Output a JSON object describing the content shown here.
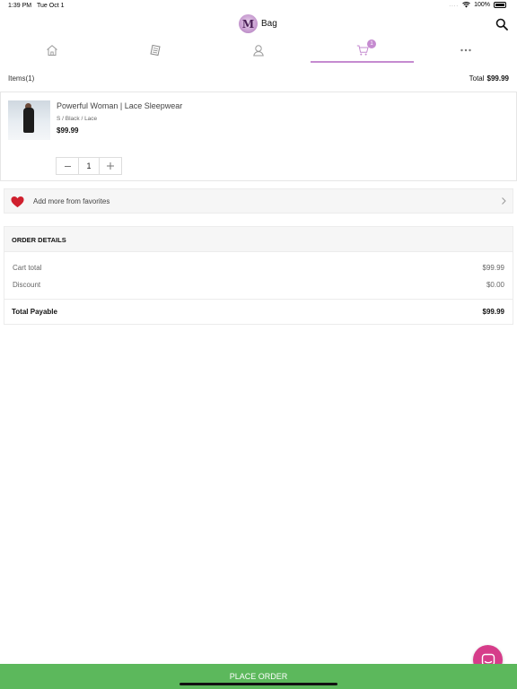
{
  "status_bar": {
    "time": "1:39 PM",
    "date": "Tue Oct 1",
    "signal": "....",
    "battery": "100%"
  },
  "header": {
    "logo_letter": "M",
    "title": "Bag"
  },
  "tabs": [
    {
      "name": "home",
      "icon": "home-icon"
    },
    {
      "name": "catalog",
      "icon": "catalog-icon"
    },
    {
      "name": "account",
      "icon": "user-icon"
    },
    {
      "name": "bag",
      "icon": "cart-icon",
      "badge": "1",
      "active": true
    },
    {
      "name": "more",
      "icon": "more-icon"
    }
  ],
  "summary": {
    "items_label": "Items(1)",
    "total_label": "Total",
    "total_value": "$99.99"
  },
  "cart": {
    "items": [
      {
        "name": "Powerful Woman | Lace Sleepwear",
        "variant": "S / Black / Lace",
        "price": "$99.99",
        "quantity": "1"
      }
    ]
  },
  "favorites": {
    "label": "Add more from favorites"
  },
  "order_details": {
    "title": "ORDER DETAILS",
    "cart_total_label": "Cart total",
    "cart_total_value": "$99.99",
    "discount_label": "Discount",
    "discount_value": "$0.00",
    "payable_label": "Total Payable",
    "payable_value": "$99.99"
  },
  "actions": {
    "place_order": "PLACE ORDER"
  },
  "colors": {
    "accent": "#c58bd0",
    "place_order_bg": "#5cb85c",
    "chat_fab": "#d63c8a",
    "heart": "#d0202e"
  }
}
